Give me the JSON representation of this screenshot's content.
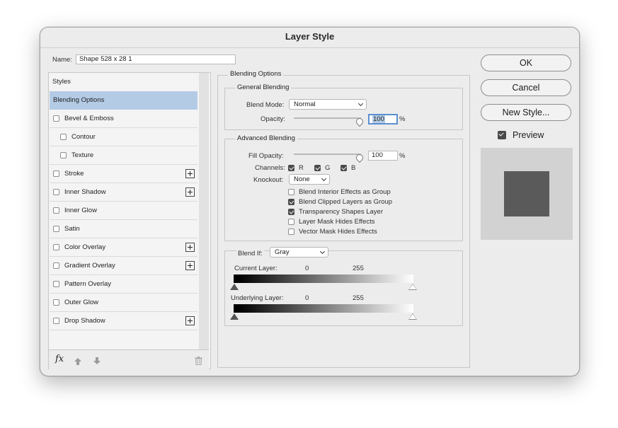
{
  "window": {
    "title": "Layer Style"
  },
  "name_field": {
    "label": "Name:",
    "value": "Shape 528 x 28 1"
  },
  "styles_list": {
    "header": "Styles",
    "items": [
      {
        "label": "Blending Options",
        "checkbox": false,
        "plus": false,
        "indent": false,
        "selected": true
      },
      {
        "label": "Bevel & Emboss",
        "checkbox": true,
        "checked": false,
        "plus": false,
        "indent": false
      },
      {
        "label": "Contour",
        "checkbox": true,
        "checked": false,
        "plus": false,
        "indent": true
      },
      {
        "label": "Texture",
        "checkbox": true,
        "checked": false,
        "plus": false,
        "indent": true
      },
      {
        "label": "Stroke",
        "checkbox": true,
        "checked": false,
        "plus": true,
        "indent": false
      },
      {
        "label": "Inner Shadow",
        "checkbox": true,
        "checked": false,
        "plus": true,
        "indent": false
      },
      {
        "label": "Inner Glow",
        "checkbox": true,
        "checked": false,
        "plus": false,
        "indent": false
      },
      {
        "label": "Satin",
        "checkbox": true,
        "checked": false,
        "plus": false,
        "indent": false
      },
      {
        "label": "Color Overlay",
        "checkbox": true,
        "checked": false,
        "plus": true,
        "indent": false
      },
      {
        "label": "Gradient Overlay",
        "checkbox": true,
        "checked": false,
        "plus": true,
        "indent": false
      },
      {
        "label": "Pattern Overlay",
        "checkbox": true,
        "checked": false,
        "plus": false,
        "indent": false
      },
      {
        "label": "Outer Glow",
        "checkbox": true,
        "checked": false,
        "plus": false,
        "indent": false
      },
      {
        "label": "Drop Shadow",
        "checkbox": true,
        "checked": false,
        "plus": true,
        "indent": false
      }
    ],
    "footer": {
      "fx_label": "fx"
    }
  },
  "blending": {
    "title": "Blending Options",
    "general": {
      "title": "General Blending",
      "blend_mode_label": "Blend Mode:",
      "blend_mode_value": "Normal",
      "opacity_label": "Opacity:",
      "opacity_value": "100",
      "opacity_unit": "%"
    },
    "advanced": {
      "title": "Advanced Blending",
      "fill_opacity_label": "Fill Opacity:",
      "fill_opacity_value": "100",
      "fill_opacity_unit": "%",
      "channels_label": "Channels:",
      "channel_r": "R",
      "channel_g": "G",
      "channel_b": "B",
      "knockout_label": "Knockout:",
      "knockout_value": "None",
      "options": [
        {
          "label": "Blend Interior Effects as Group",
          "checked": false
        },
        {
          "label": "Blend Clipped Layers as Group",
          "checked": true
        },
        {
          "label": "Transparency Shapes Layer",
          "checked": true
        },
        {
          "label": "Layer Mask Hides Effects",
          "checked": false
        },
        {
          "label": "Vector Mask Hides Effects",
          "checked": false
        }
      ]
    },
    "blend_if": {
      "label": "Blend If:",
      "value": "Gray",
      "current_label": "Current Layer:",
      "current_low": "0",
      "current_high": "255",
      "underlying_label": "Underlying Layer:",
      "underlying_low": "0",
      "underlying_high": "255"
    }
  },
  "buttons": {
    "ok": "OK",
    "cancel": "Cancel",
    "new_style": "New Style..."
  },
  "preview": {
    "label": "Preview",
    "checked": true,
    "swatch_color": "#5a5a5a",
    "bg_color": "#d2d2d2"
  }
}
